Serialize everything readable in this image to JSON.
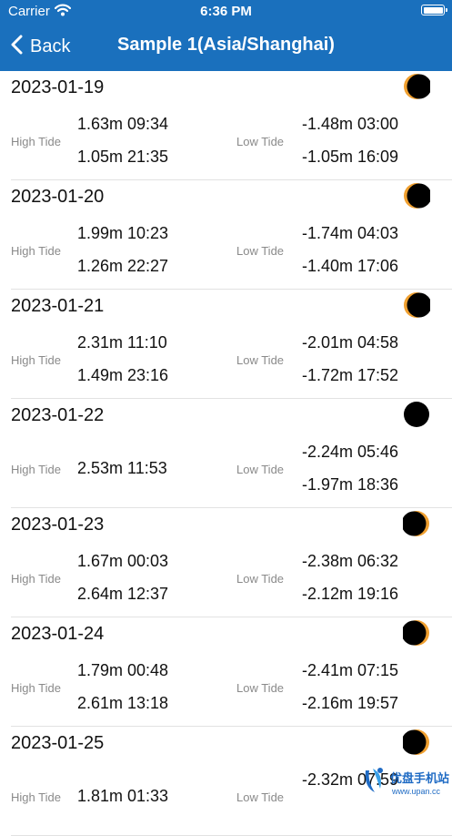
{
  "status_bar": {
    "carrier": "Carrier",
    "time": "6:36 PM"
  },
  "nav": {
    "back_label": "Back",
    "title": "Sample 1(Asia/Shanghai)"
  },
  "labels": {
    "high": "High Tide",
    "low": "Low Tide"
  },
  "days": [
    {
      "date": "2023-01-19",
      "moon": "waning-crescent",
      "high": [
        "1.63m 09:34",
        "1.05m 21:35"
      ],
      "low": [
        "-1.48m 03:00",
        "-1.05m 16:09"
      ]
    },
    {
      "date": "2023-01-20",
      "moon": "waning-crescent",
      "high": [
        "1.99m 10:23",
        "1.26m 22:27"
      ],
      "low": [
        "-1.74m 04:03",
        "-1.40m 17:06"
      ]
    },
    {
      "date": "2023-01-21",
      "moon": "waning-crescent",
      "high": [
        "2.31m 11:10",
        "1.49m 23:16"
      ],
      "low": [
        "-2.01m 04:58",
        "-1.72m 17:52"
      ]
    },
    {
      "date": "2023-01-22",
      "moon": "new-moon",
      "high": [
        "2.53m 11:53"
      ],
      "low": [
        "-2.24m 05:46",
        "-1.97m 18:36"
      ]
    },
    {
      "date": "2023-01-23",
      "moon": "waxing-crescent",
      "high": [
        "1.67m 00:03",
        "2.64m 12:37"
      ],
      "low": [
        "-2.38m 06:32",
        "-2.12m 19:16"
      ]
    },
    {
      "date": "2023-01-24",
      "moon": "waxing-crescent",
      "high": [
        "1.79m 00:48",
        "2.61m 13:18"
      ],
      "low": [
        "-2.41m 07:15",
        "-2.16m 19:57"
      ]
    },
    {
      "date": "2023-01-25",
      "moon": "waxing-crescent",
      "high": [
        "1.81m 01:33"
      ],
      "low": [
        "-2.32m 07:59"
      ]
    }
  ],
  "watermark": {
    "name": "优盘手机站",
    "url": "www.upan.cc"
  },
  "colors": {
    "nav_bar": "#1a70bd",
    "moon_lit": "#f0a030",
    "moon_dark": "#000000"
  }
}
